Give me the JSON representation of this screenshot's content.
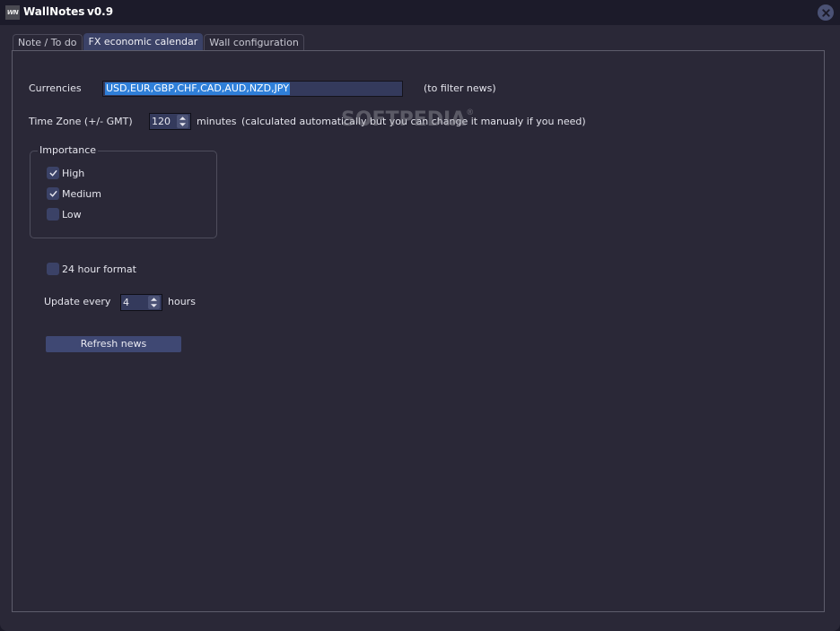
{
  "titlebar": {
    "logo_text": "WN",
    "app_name": "WallNotes",
    "version": "v0.9",
    "close_icon": "close-icon"
  },
  "tabs": [
    {
      "label": "Note / To do",
      "active": false
    },
    {
      "label": "FX economic calendar",
      "active": true
    },
    {
      "label": "Wall configuration",
      "active": false
    }
  ],
  "form": {
    "currencies": {
      "label": "Currencies",
      "value": "USD,EUR,GBP,CHF,CAD,AUD,NZD,JPY",
      "hint": "(to filter news)"
    },
    "timezone": {
      "label": "Time Zone (+/- GMT)",
      "value": "120",
      "unit": "minutes",
      "hint": "(calculated automatically but you can change it manualy  if you need)"
    },
    "importance": {
      "title": "Importance",
      "options": [
        {
          "label": "High",
          "checked": true
        },
        {
          "label": "Medium",
          "checked": true
        },
        {
          "label": "Low",
          "checked": false
        }
      ]
    },
    "hour_format": {
      "label": "24 hour format",
      "checked": false
    },
    "update": {
      "label": "Update every",
      "value": "4",
      "unit": "hours"
    },
    "refresh_button": "Refresh news"
  },
  "watermark": "SOFTPEDIA",
  "colors": {
    "background": "#2a2837",
    "titlebar": "#1c1b2a",
    "accent": "#3b4267",
    "selection": "#2f7fd8"
  }
}
